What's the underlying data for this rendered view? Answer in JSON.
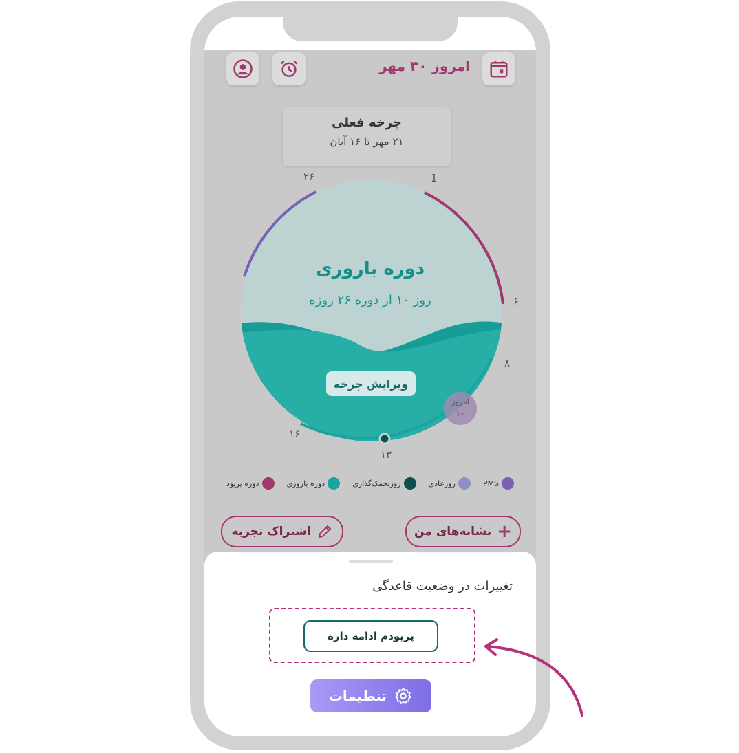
{
  "header": {
    "today_label": "امروز ۳۰ مهر",
    "icons": [
      "calendar-icon",
      "alarm-icon",
      "profile-icon"
    ]
  },
  "cycle_card": {
    "title": "چرخه فعلی",
    "range": "۲۱ مهر تا ۱۶ آبان"
  },
  "cycle_circle": {
    "phase_title": "دوره باروری",
    "phase_subtitle": "روز ۱۰ از دوره ۲۶ روزه",
    "edit_button": "ویرایش چرخه",
    "today_marker_label": "امروز",
    "today_marker_day": "۱۰",
    "ring_labels": {
      "d1": "1",
      "d6": "۶",
      "d8": "۸",
      "d13": "۱۳",
      "d16": "۱۶",
      "d26": "۲۶"
    },
    "colors": {
      "period": "#a3386f",
      "fertile": "#1aa5a0",
      "ovulation": "#0c4f4d",
      "normal": "#8e8fc7",
      "pms": "#7a61b8"
    }
  },
  "legend": [
    {
      "label": "دوره پریود",
      "color": "#a3386f"
    },
    {
      "label": "دوره باروری",
      "color": "#1aa5a0"
    },
    {
      "label": "روزتخمک‌گذاری",
      "color": "#0c4f4d"
    },
    {
      "label": "روزعادی",
      "color": "#8e8fc7"
    },
    {
      "label": "PMS",
      "color": "#7a61b8"
    }
  ],
  "actions": {
    "my_signs": "نشانه‌های من",
    "share_experience": "اشتراک تجربه"
  },
  "sheet": {
    "title": "تغییرات در وضعیت قاعدگی",
    "continue_button": "پریودم ادامه داره",
    "settings_button": "تنظیمات"
  }
}
